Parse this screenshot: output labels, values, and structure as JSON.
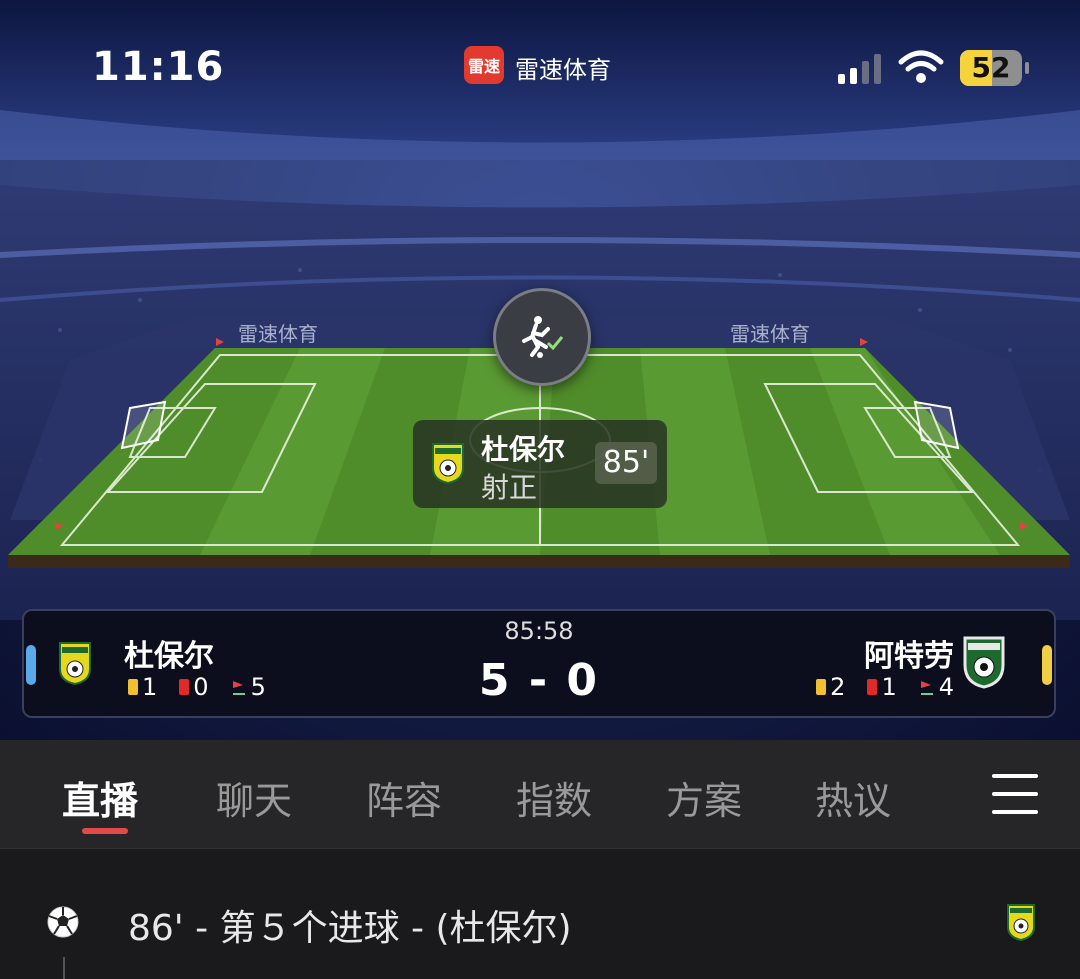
{
  "status_bar": {
    "time": "11:16",
    "app_badge": "雷速",
    "app_name": "雷速体育",
    "battery": "52"
  },
  "pitch": {
    "ad_text": "雷速体育",
    "event_icon": "kick-check-icon"
  },
  "event_popup": {
    "team": "杜保尔",
    "event": "射正",
    "minute": "85'"
  },
  "match": {
    "clock": "85:58",
    "score": "5 - 0",
    "home": {
      "name": "杜保尔",
      "yellow": "1",
      "red": "0",
      "corners": "5",
      "color": "#5aa9ea"
    },
    "away": {
      "name": "阿特劳",
      "yellow": "2",
      "red": "1",
      "corners": "4",
      "color": "#f0cf46"
    }
  },
  "tabs": [
    {
      "label": "直播"
    },
    {
      "label": "聊天"
    },
    {
      "label": "阵容"
    },
    {
      "label": "指数"
    },
    {
      "label": "方案"
    },
    {
      "label": "热议"
    }
  ],
  "feed": [
    {
      "text": "86' - 第５个进球 - (杜保尔)",
      "icon": "football-icon"
    }
  ],
  "colors": {
    "pitch": "#4f8c2a",
    "accent": "#e24a4a",
    "yellow_card": "#f0c030",
    "red_card": "#e02a2a"
  }
}
